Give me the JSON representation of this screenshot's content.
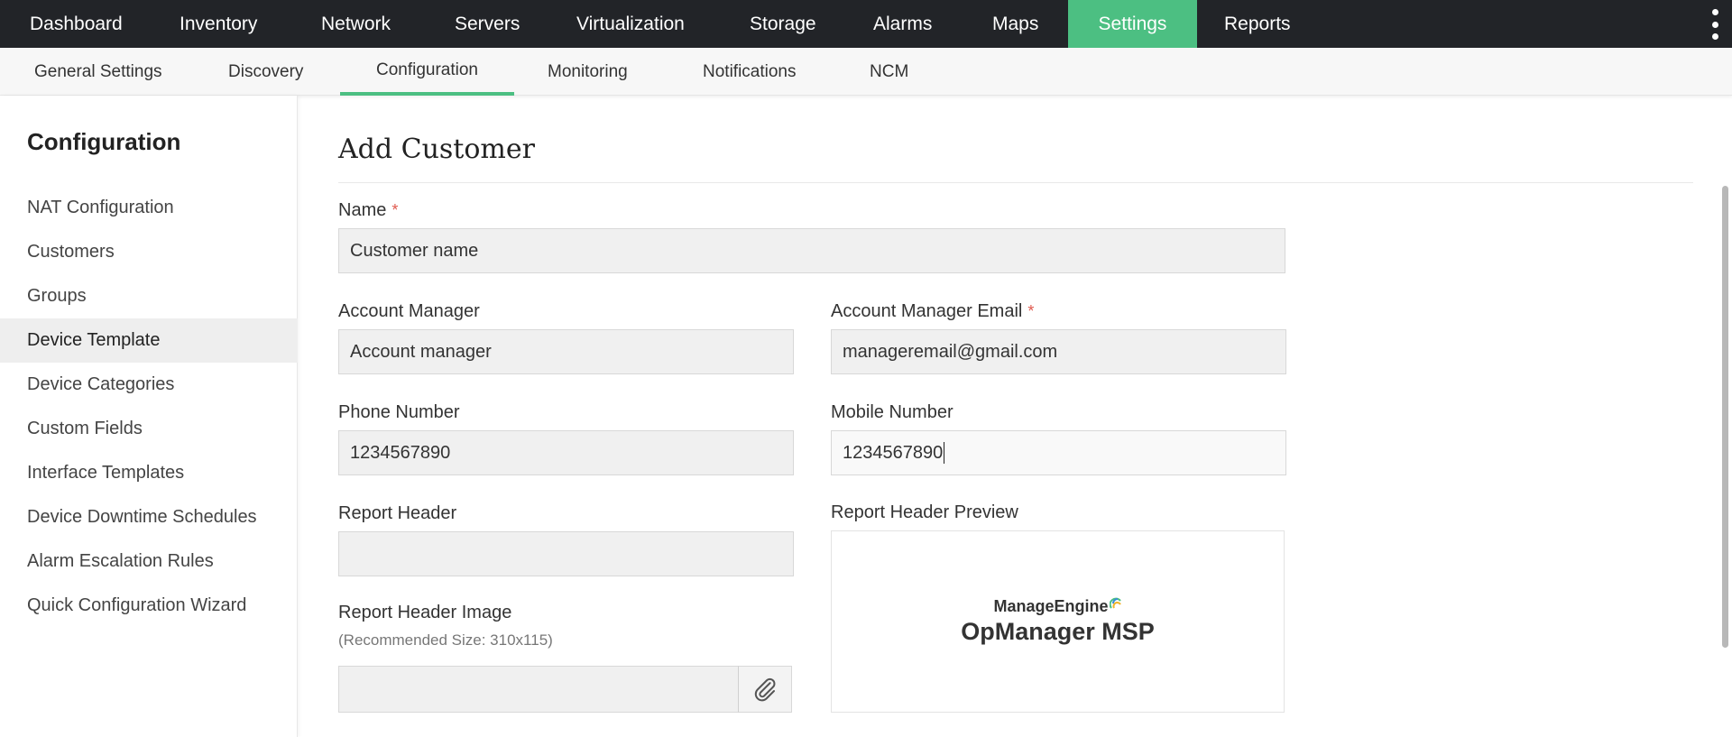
{
  "topnav": {
    "tabs": [
      {
        "label": "Dashboard",
        "active": false
      },
      {
        "label": "Inventory",
        "active": false
      },
      {
        "label": "Network",
        "active": false
      },
      {
        "label": "Servers",
        "active": false
      },
      {
        "label": "Virtualization",
        "active": false
      },
      {
        "label": "Storage",
        "active": false
      },
      {
        "label": "Alarms",
        "active": false
      },
      {
        "label": "Maps",
        "active": false
      },
      {
        "label": "Settings",
        "active": true
      },
      {
        "label": "Reports",
        "active": false
      }
    ],
    "active_color": "#4cbf82"
  },
  "subnav": {
    "tabs": [
      {
        "label": "General Settings",
        "active": false
      },
      {
        "label": "Discovery",
        "active": false
      },
      {
        "label": "Configuration",
        "active": true
      },
      {
        "label": "Monitoring",
        "active": false
      },
      {
        "label": "Notifications",
        "active": false
      },
      {
        "label": "NCM",
        "active": false
      }
    ]
  },
  "sidebar": {
    "title": "Configuration",
    "items": [
      {
        "label": "NAT Configuration",
        "active": false
      },
      {
        "label": "Customers",
        "active": false
      },
      {
        "label": "Groups",
        "active": false
      },
      {
        "label": "Device Template",
        "active": true
      },
      {
        "label": "Device Categories",
        "active": false
      },
      {
        "label": "Custom Fields",
        "active": false
      },
      {
        "label": "Interface Templates",
        "active": false
      },
      {
        "label": "Device Downtime Schedules",
        "active": false
      },
      {
        "label": "Alarm Escalation Rules",
        "active": false
      },
      {
        "label": "Quick Configuration Wizard",
        "active": false
      }
    ]
  },
  "form": {
    "title": "Add Customer",
    "required_mark": "*",
    "name": {
      "label": "Name",
      "value": "Customer name"
    },
    "account_manager": {
      "label": "Account Manager",
      "value": "Account manager"
    },
    "account_manager_email": {
      "label": "Account Manager Email",
      "value": "manageremail@gmail.com"
    },
    "phone_number": {
      "label": "Phone Number",
      "value": "1234567890"
    },
    "mobile_number": {
      "label": "Mobile Number",
      "value": "1234567890"
    },
    "report_header": {
      "label": "Report Header",
      "value": ""
    },
    "report_header_preview": {
      "label": "Report Header Preview",
      "logo_brand": "ManageEngine",
      "logo_product": "OpManager MSP"
    },
    "report_header_image": {
      "label": "Report Header Image",
      "hint": "(Recommended Size: 310x115)",
      "value": ""
    }
  },
  "icons": {
    "attach": "paperclip-icon",
    "more": "kebab-menu-icon"
  }
}
